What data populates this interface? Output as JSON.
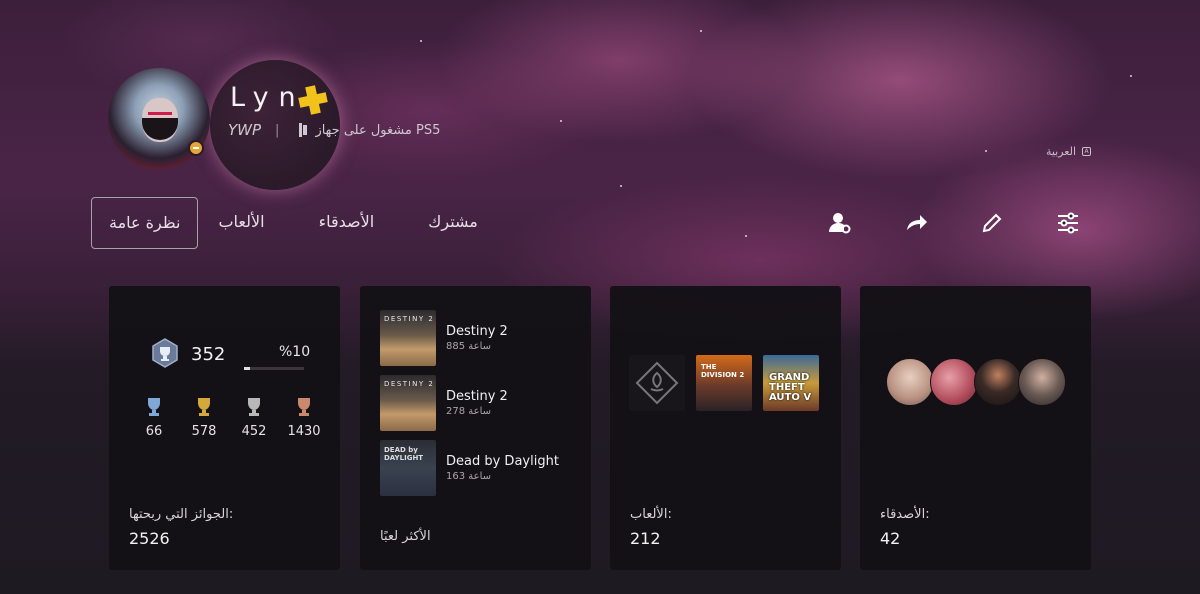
{
  "profile": {
    "username": "Lyn",
    "tag": "YWP",
    "separator": "|",
    "status": "مشغول على جهاز PS5",
    "plus_icon": "ps-plus-icon",
    "console_icon": "ps5-console-icon"
  },
  "language": {
    "label": "العربية",
    "icon": "language-icon"
  },
  "tabs": [
    {
      "label": "نظرة عامة",
      "active": true
    },
    {
      "label": "الألعاب"
    },
    {
      "label": "الأصدقاء"
    },
    {
      "label": "مشترك"
    }
  ],
  "actions": [
    {
      "icon": "add-friend-icon"
    },
    {
      "icon": "share-icon"
    },
    {
      "icon": "edit-icon"
    },
    {
      "icon": "settings-sliders-icon"
    }
  ],
  "trophies": {
    "level": "352",
    "progress_label": "%10",
    "progress": 0.1,
    "counts": [
      {
        "type": "platinum",
        "value": "66",
        "color": "#7fa7d8"
      },
      {
        "type": "gold",
        "value": "578",
        "color": "#d4a83a"
      },
      {
        "type": "silver",
        "value": "452",
        "color": "#b8b8b8"
      },
      {
        "type": "bronze",
        "value": "1430",
        "color": "#c88a6a"
      }
    ],
    "label": "الجوائز التي ربحتها:",
    "total": "2526"
  },
  "most_played": {
    "items": [
      {
        "title": "Destiny 2",
        "hours": "885 ساعة",
        "thumb_text": "DESTINY 2"
      },
      {
        "title": "Destiny 2",
        "hours": "278 ساعة",
        "thumb_text": "DESTINY 2"
      },
      {
        "title": "Dead by Daylight",
        "hours": "163 ساعة",
        "thumb_text": "DEAD by DAYLIGHT"
      }
    ],
    "label": "الأكثر لعبًا"
  },
  "games": {
    "thumbs": [
      "THE DIVISION 2",
      "GRAND THEFT AUTO V"
    ],
    "label": "الألعاب:",
    "count": "212"
  },
  "friends": {
    "label": "الأصدقاء:",
    "count": "42"
  },
  "colors": {
    "plus": "#f0c21b",
    "card_bg": "#131116"
  }
}
